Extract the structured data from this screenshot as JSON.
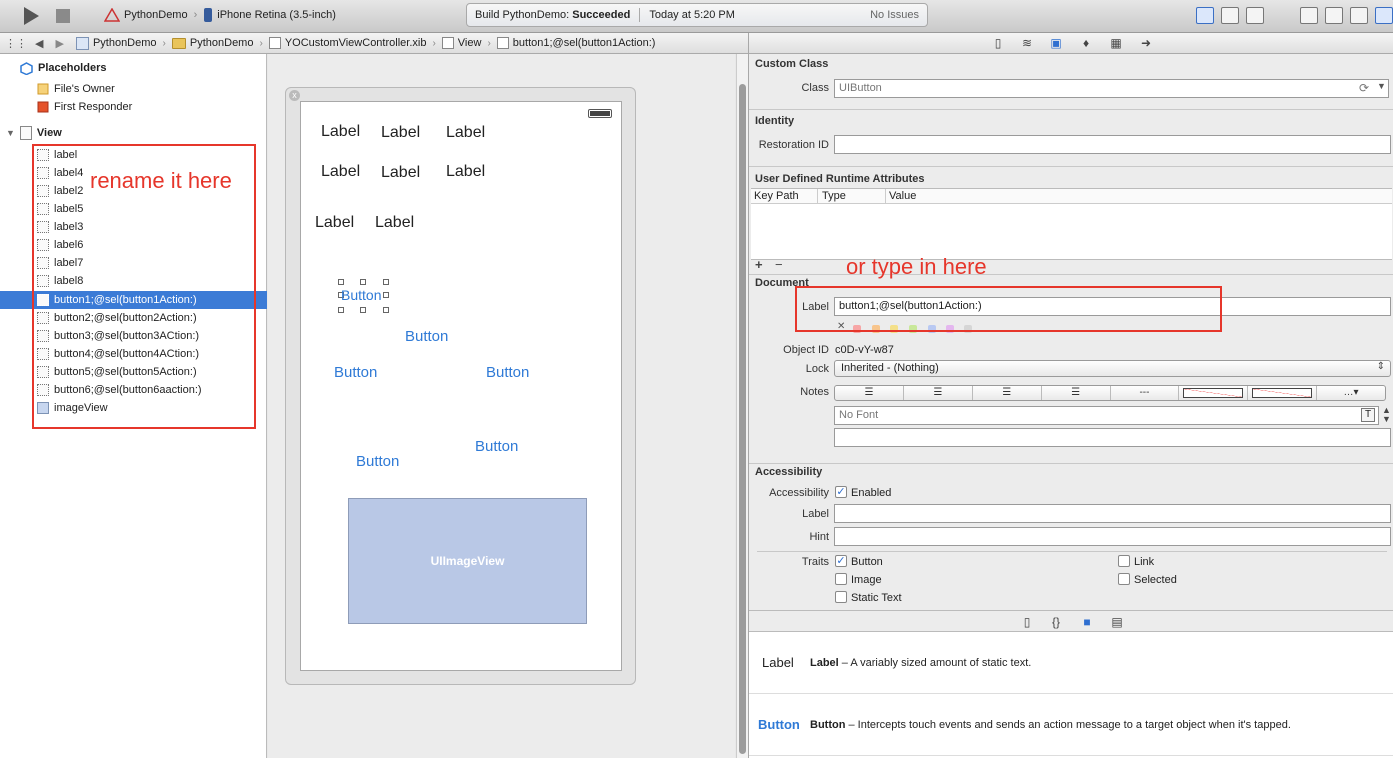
{
  "toolbar": {
    "project": "PythonDemo",
    "device": "iPhone Retina (3.5-inch)",
    "build_label": "Build PythonDemo:",
    "build_status": "Succeeded",
    "build_time": "Today at 5:20 PM",
    "issues": "No Issues"
  },
  "jumpbar": {
    "items": [
      "PythonDemo",
      "PythonDemo",
      "YOCustomViewController.xib",
      "View",
      "button1;@sel(button1Action:)"
    ]
  },
  "outline": {
    "placeholders": "Placeholders",
    "files_owner": "File's Owner",
    "first_responder": "First Responder",
    "view": "View",
    "items": [
      "label",
      "label4",
      "label2",
      "label5",
      "label3",
      "label6",
      "label7",
      "label8",
      "button1;@sel(button1Action:)",
      "button2;@sel(button2Action:)",
      "button3;@sel(button3ACtion:)",
      "button4;@sel(button4ACtion:)",
      "button5;@sel(button5Action:)",
      "button6;@sel(button6aaction:)",
      "imageView"
    ],
    "selected_index": 8,
    "annotation": "rename it here"
  },
  "canvas": {
    "label_text": "Label",
    "button_text": "Button",
    "imageview_text": "UIImageView",
    "close_glyph": "x"
  },
  "inspector": {
    "custom_class": {
      "title": "Custom Class",
      "class_label": "Class",
      "class_placeholder": "UIButton"
    },
    "identity": {
      "title": "Identity",
      "restoration_label": "Restoration ID"
    },
    "runtime": {
      "title": "User Defined Runtime Attributes",
      "col_key": "Key Path",
      "col_type": "Type",
      "col_value": "Value",
      "add": "+",
      "remove": "−"
    },
    "document": {
      "title": "Document",
      "label_label": "Label",
      "label_value": "button1;@sel(button1Action:)",
      "object_id_label": "Object ID",
      "object_id": "c0D-vY-w87",
      "lock_label": "Lock",
      "lock_value": "Inherited - (Nothing)",
      "notes_label": "Notes",
      "font_placeholder": "No Font",
      "clear_glyph": "✕",
      "annotation": "or type in here",
      "colors": [
        "#f7a6a6",
        "#f8c58c",
        "#f4e08a",
        "#c9e89a",
        "#b9c9f2",
        "#e4b7ef",
        "#d6d6d6"
      ]
    },
    "accessibility": {
      "title": "Accessibility",
      "accessibility_label": "Accessibility",
      "enabled": "Enabled",
      "label_label": "Label",
      "hint_label": "Hint",
      "traits_label": "Traits",
      "traits": {
        "button": "Button",
        "image": "Image",
        "static_text": "Static Text",
        "link": "Link",
        "selected": "Selected"
      }
    },
    "library": [
      {
        "big": "Label",
        "name": "Label",
        "desc": " – A variably sized amount of static text."
      },
      {
        "big": "Button",
        "name": "Button",
        "desc": " – Intercepts touch events and sends an action message to a target object when it's tapped."
      }
    ]
  },
  "colors": {
    "selection": "#3b7bd6",
    "annotation": "#e6362b",
    "button_text": "#2f7ad6"
  }
}
